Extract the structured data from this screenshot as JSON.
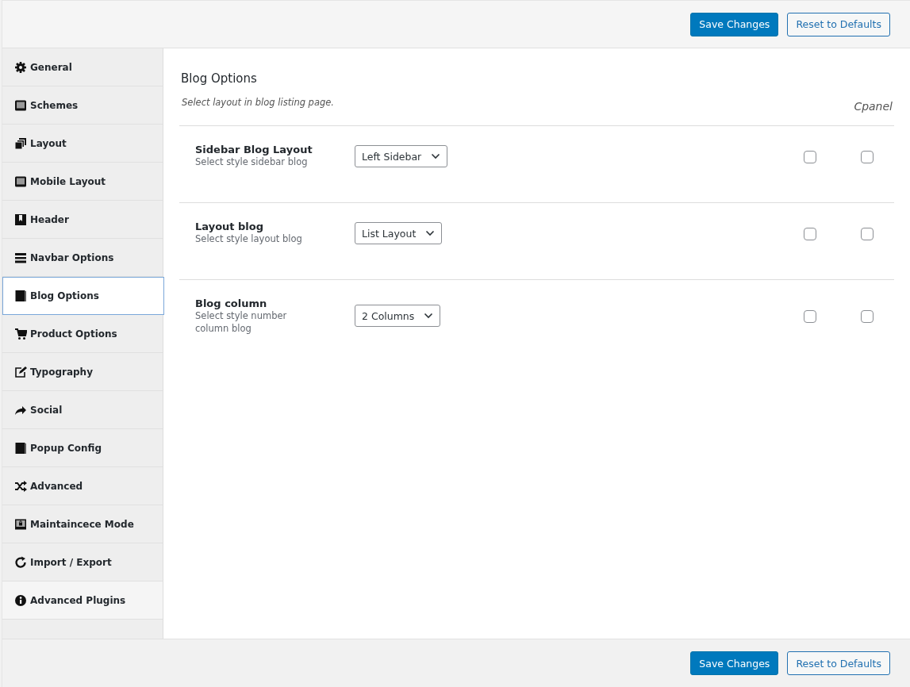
{
  "toolbar": {
    "buttons": [
      {
        "label": "Save Changes",
        "kind": "primary"
      },
      {
        "label": "Reset to Defaults",
        "kind": "secondary"
      }
    ]
  },
  "sidebar": {
    "items": [
      {
        "label": "General",
        "selected": false
      },
      {
        "label": "Schemes",
        "selected": false
      },
      {
        "label": "Layout",
        "selected": false
      },
      {
        "label": "Mobile Layout",
        "selected": false
      },
      {
        "label": "Header",
        "selected": false
      },
      {
        "label": "Navbar Options",
        "selected": false
      },
      {
        "label": "Blog Options",
        "selected": true
      },
      {
        "label": "Product Options",
        "selected": false
      },
      {
        "label": "Typography",
        "selected": false
      },
      {
        "label": "Social",
        "selected": false
      },
      {
        "label": "Popup Config",
        "selected": false
      },
      {
        "label": "Advanced",
        "selected": false
      },
      {
        "label": "Maintaincece Mode",
        "selected": false
      },
      {
        "label": "Import / Export",
        "selected": false
      },
      {
        "label": "Advanced Plugins",
        "selected": false
      }
    ]
  },
  "section": {
    "title": "Blog Options",
    "description": "Select layout in blog listing page.",
    "column_label": "Cpanel",
    "rows": [
      {
        "label": "Sidebar Blog Layout",
        "hint": "Select style sidebar blog",
        "value": "Left Sidebar",
        "checkboxes": [
          {
            "checked": false
          },
          {
            "checked": false
          }
        ]
      },
      {
        "label": "Layout blog",
        "hint": "Select style layout blog",
        "value": "List Layout",
        "checkboxes": [
          {
            "checked": false
          },
          {
            "checked": false
          }
        ]
      },
      {
        "label": "Blog column",
        "hint": "Select style number column blog",
        "value": "2 Columns",
        "checkboxes": [
          {
            "checked": false
          },
          {
            "checked": false
          }
        ]
      }
    ]
  },
  "footer": {
    "buttons": [
      {
        "label": "Save Changes",
        "kind": "primary"
      },
      {
        "label": "Reset to Defaults",
        "kind": "secondary"
      }
    ]
  }
}
